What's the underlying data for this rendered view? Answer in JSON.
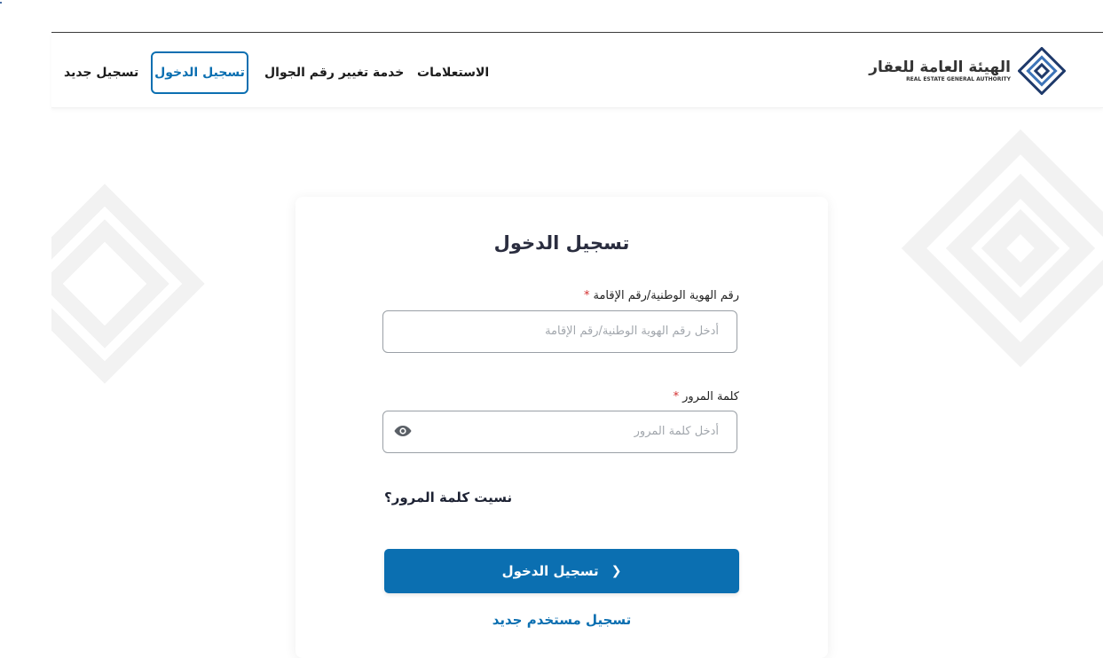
{
  "nav": {
    "register": "تسجيل جديد",
    "login": "تسجيل الدخول",
    "change_mobile": "خدمة تغيير رقم الجوال",
    "inquiries": "الاستعلامات"
  },
  "logo": {
    "name_ar": "الهيئة العامة للعقار",
    "name_en": "REAL ESTATE GENERAL AUTHORITY",
    "icon": "rega-logo-icon"
  },
  "form": {
    "title": "تسجيل الدخول",
    "id_label": "رقم الهوية الوطنية/رقم الإقامة",
    "id_placeholder": "أدخل رقم الهوية الوطنية/رقم الإقامة",
    "password_label": "كلمة المرور",
    "password_placeholder": "أدخل كلمة المرور",
    "required_mark": "*",
    "forgot_password": "نسيت كلمة المرور؟",
    "submit_label": "تسجيل الدخول",
    "submit_icon": "chevron-left-icon",
    "new_user": "تسجيل مستخدم جديد"
  },
  "colors": {
    "primary": "#0b6fb1",
    "required": "#d32f2f",
    "logo": "#1f3a6b"
  }
}
